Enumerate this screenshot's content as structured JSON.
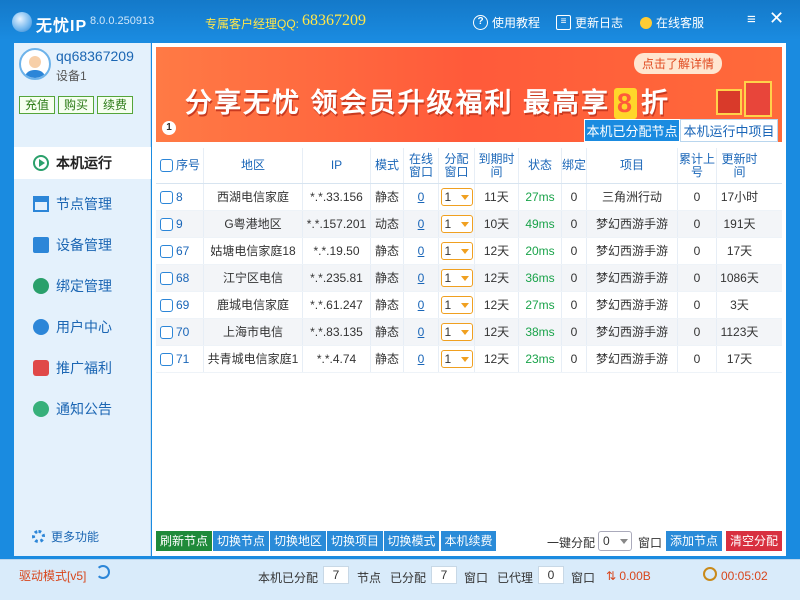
{
  "app": {
    "name": "无忧IP",
    "version": "8.0.0.250913",
    "qq_label": "专属客户经理QQ:",
    "qq_number": "68367209"
  },
  "titlebar": {
    "tutorial": "使用教程",
    "changelog": "更新日志",
    "service": "在线客服"
  },
  "account": {
    "username": "qq68367209",
    "device": "设备1",
    "buttons": [
      "充值",
      "购买",
      "续费"
    ]
  },
  "nav": [
    "本机运行",
    "节点管理",
    "设备管理",
    "绑定管理",
    "用户中心",
    "推广福利",
    "通知公告"
  ],
  "more": "更多功能",
  "banner": {
    "text_a": "分享无忧 领会员升级福利 最高享",
    "big": "8",
    "text_b": "折",
    "link": "点击了解详情",
    "page": "1"
  },
  "tabs": [
    "本机已分配节点",
    "本机运行中项目"
  ],
  "table": {
    "headers": [
      "序号",
      "地区",
      "IP",
      "模式",
      "在线窗口",
      "分配窗口",
      "到期时间",
      "状态",
      "绑定",
      "项目",
      "累计上号",
      "更新时间"
    ],
    "rows": [
      {
        "id": "8",
        "region": "西湖电信家庭",
        "ip": "*.*.33.156",
        "mode": "静态",
        "online": "0",
        "assign": "1",
        "expire": "11天",
        "status": "27ms",
        "bind": "0",
        "project": "三角洲行动",
        "total": "0",
        "updated": "17小时"
      },
      {
        "id": "9",
        "region": "G粤港地区",
        "ip": "*.*.157.201",
        "mode": "动态",
        "online": "0",
        "assign": "1",
        "expire": "10天",
        "status": "49ms",
        "bind": "0",
        "project": "梦幻西游手游",
        "total": "0",
        "updated": "191天"
      },
      {
        "id": "67",
        "region": "姑塘电信家庭18",
        "ip": "*.*.19.50",
        "mode": "静态",
        "online": "0",
        "assign": "1",
        "expire": "12天",
        "status": "20ms",
        "bind": "0",
        "project": "梦幻西游手游",
        "total": "0",
        "updated": "17天"
      },
      {
        "id": "68",
        "region": "江宁区电信",
        "ip": "*.*.235.81",
        "mode": "静态",
        "online": "0",
        "assign": "1",
        "expire": "12天",
        "status": "36ms",
        "bind": "0",
        "project": "梦幻西游手游",
        "total": "0",
        "updated": "1086天"
      },
      {
        "id": "69",
        "region": "鹿城电信家庭",
        "ip": "*.*.61.247",
        "mode": "静态",
        "online": "0",
        "assign": "1",
        "expire": "12天",
        "status": "27ms",
        "bind": "0",
        "project": "梦幻西游手游",
        "total": "0",
        "updated": "3天"
      },
      {
        "id": "70",
        "region": "上海市电信",
        "ip": "*.*.83.135",
        "mode": "静态",
        "online": "0",
        "assign": "1",
        "expire": "12天",
        "status": "38ms",
        "bind": "0",
        "project": "梦幻西游手游",
        "total": "0",
        "updated": "1123天"
      },
      {
        "id": "71",
        "region": "共青城电信家庭1",
        "ip": "*.*.4.74",
        "mode": "静态",
        "online": "0",
        "assign": "1",
        "expire": "12天",
        "status": "23ms",
        "bind": "0",
        "project": "梦幻西游手游",
        "total": "0",
        "updated": "17天"
      }
    ]
  },
  "actions": {
    "refresh": "刷新节点",
    "switch_node": "切换节点",
    "switch_area": "切换地区",
    "switch_project": "切换项目",
    "switch_mode": "切换模式",
    "renew": "本机续费",
    "assign_label": "一键分配",
    "assign_value": "0",
    "assign_unit": "窗口",
    "add_node": "添加节点",
    "clear": "清空分配"
  },
  "status": {
    "driver": "驱动模式[v5]",
    "assigned_label": "本机已分配",
    "assigned_value": "7",
    "node_label": "节点",
    "allocated_label": "已分配",
    "allocated_value": "7",
    "window_label": "窗口",
    "proxied_label": "已代理",
    "proxied_value": "0",
    "window_label2": "窗口",
    "bandwidth": "0.00B",
    "elapsed": "00:05:02"
  },
  "colors": {
    "primary": "#1a8be0",
    "accent_green": "#1aa34a",
    "danger": "#d83040",
    "banner": "#ff5a3a"
  }
}
